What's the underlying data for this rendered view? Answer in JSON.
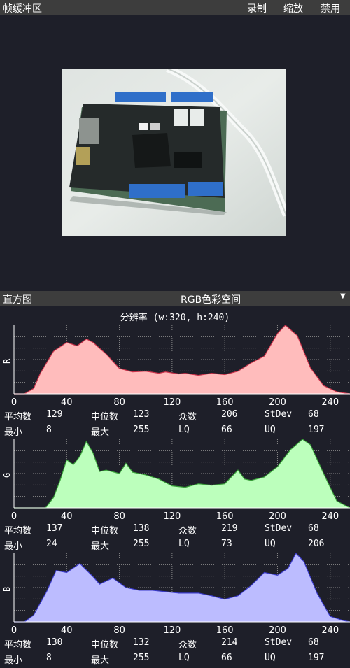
{
  "topbar": {
    "title": "帧缓冲区",
    "menu": [
      "录制",
      "缩放",
      "禁用"
    ]
  },
  "framebuffer": {
    "image_label": "Arduino-style development board photo"
  },
  "histogram_bar": {
    "title": "直方图",
    "mode": "RGB色彩空间",
    "dropdown_icon": "caret-down-icon"
  },
  "resolution": "分辨率 (w:320, h:240)",
  "stat_labels": {
    "mean": "平均数",
    "median": "中位数",
    "mode": "众数",
    "stdev": "StDev",
    "min": "最小",
    "max": "最大",
    "lq": "LQ",
    "uq": "UQ"
  },
  "channels": [
    {
      "name": "R",
      "color": "#ffbcbc",
      "stats": {
        "mean": "129",
        "median": "123",
        "mode": "206",
        "stdev": "68",
        "min": "8",
        "max": "255",
        "lq": "66",
        "uq": "197"
      }
    },
    {
      "name": "G",
      "color": "#bcffbc",
      "stats": {
        "mean": "137",
        "median": "138",
        "mode": "219",
        "stdev": "68",
        "min": "24",
        "max": "255",
        "lq": "73",
        "uq": "206"
      }
    },
    {
      "name": "B",
      "color": "#bcbcff",
      "stats": {
        "mean": "130",
        "median": "132",
        "mode": "214",
        "stdev": "68",
        "min": "8",
        "max": "255",
        "lq": "66",
        "uq": "197"
      }
    }
  ],
  "chart_data": [
    {
      "type": "area",
      "ylabel": "R",
      "x_ticks": [
        "0",
        "40",
        "80",
        "120",
        "160",
        "200",
        "240"
      ],
      "xlim": [
        0,
        255
      ],
      "ylim": [
        0,
        100
      ],
      "grid": true,
      "x": [
        0,
        8,
        15,
        20,
        30,
        40,
        48,
        55,
        60,
        70,
        80,
        90,
        100,
        110,
        115,
        125,
        130,
        140,
        150,
        160,
        170,
        180,
        190,
        200,
        206,
        215,
        225,
        235,
        245,
        255
      ],
      "values": [
        0,
        0,
        8,
        30,
        62,
        75,
        70,
        80,
        75,
        58,
        37,
        32,
        33,
        30,
        32,
        29,
        30,
        27,
        30,
        28,
        33,
        45,
        55,
        88,
        100,
        85,
        38,
        12,
        3,
        0
      ]
    },
    {
      "type": "area",
      "ylabel": "G",
      "x_ticks": [
        "0",
        "40",
        "80",
        "120",
        "160",
        "200",
        "240"
      ],
      "xlim": [
        0,
        255
      ],
      "ylim": [
        0,
        100
      ],
      "grid": true,
      "x": [
        0,
        24,
        30,
        35,
        40,
        45,
        50,
        55,
        60,
        65,
        70,
        80,
        85,
        90,
        100,
        110,
        120,
        130,
        140,
        150,
        160,
        170,
        175,
        180,
        190,
        200,
        210,
        219,
        225,
        235,
        245,
        255
      ],
      "values": [
        0,
        0,
        15,
        40,
        70,
        63,
        75,
        97,
        80,
        53,
        55,
        50,
        65,
        52,
        48,
        42,
        32,
        30,
        35,
        33,
        35,
        55,
        42,
        40,
        45,
        60,
        85,
        100,
        92,
        50,
        10,
        0
      ]
    },
    {
      "type": "area",
      "ylabel": "B",
      "x_ticks": [
        "0",
        "40",
        "80",
        "120",
        "160",
        "200",
        "240"
      ],
      "xlim": [
        0,
        255
      ],
      "ylim": [
        0,
        100
      ],
      "grid": true,
      "x": [
        0,
        8,
        15,
        25,
        32,
        40,
        50,
        60,
        65,
        75,
        85,
        95,
        105,
        115,
        125,
        140,
        150,
        160,
        170,
        180,
        190,
        200,
        208,
        214,
        220,
        230,
        240,
        250,
        255
      ],
      "values": [
        0,
        0,
        10,
        45,
        75,
        72,
        85,
        66,
        55,
        64,
        50,
        46,
        46,
        44,
        42,
        42,
        38,
        33,
        38,
        53,
        72,
        68,
        78,
        100,
        88,
        42,
        8,
        2,
        0
      ]
    }
  ]
}
